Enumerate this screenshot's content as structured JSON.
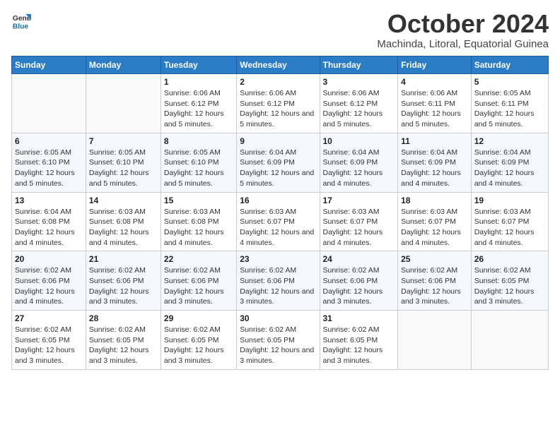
{
  "logo": {
    "line1": "General",
    "line2": "Blue"
  },
  "title": "October 2024",
  "location": "Machinda, Litoral, Equatorial Guinea",
  "days_of_week": [
    "Sunday",
    "Monday",
    "Tuesday",
    "Wednesday",
    "Thursday",
    "Friday",
    "Saturday"
  ],
  "weeks": [
    [
      {
        "num": "",
        "info": ""
      },
      {
        "num": "",
        "info": ""
      },
      {
        "num": "1",
        "info": "Sunrise: 6:06 AM\nSunset: 6:12 PM\nDaylight: 12 hours and 5 minutes."
      },
      {
        "num": "2",
        "info": "Sunrise: 6:06 AM\nSunset: 6:12 PM\nDaylight: 12 hours and 5 minutes."
      },
      {
        "num": "3",
        "info": "Sunrise: 6:06 AM\nSunset: 6:12 PM\nDaylight: 12 hours and 5 minutes."
      },
      {
        "num": "4",
        "info": "Sunrise: 6:06 AM\nSunset: 6:11 PM\nDaylight: 12 hours and 5 minutes."
      },
      {
        "num": "5",
        "info": "Sunrise: 6:05 AM\nSunset: 6:11 PM\nDaylight: 12 hours and 5 minutes."
      }
    ],
    [
      {
        "num": "6",
        "info": "Sunrise: 6:05 AM\nSunset: 6:10 PM\nDaylight: 12 hours and 5 minutes."
      },
      {
        "num": "7",
        "info": "Sunrise: 6:05 AM\nSunset: 6:10 PM\nDaylight: 12 hours and 5 minutes."
      },
      {
        "num": "8",
        "info": "Sunrise: 6:05 AM\nSunset: 6:10 PM\nDaylight: 12 hours and 5 minutes."
      },
      {
        "num": "9",
        "info": "Sunrise: 6:04 AM\nSunset: 6:09 PM\nDaylight: 12 hours and 5 minutes."
      },
      {
        "num": "10",
        "info": "Sunrise: 6:04 AM\nSunset: 6:09 PM\nDaylight: 12 hours and 4 minutes."
      },
      {
        "num": "11",
        "info": "Sunrise: 6:04 AM\nSunset: 6:09 PM\nDaylight: 12 hours and 4 minutes."
      },
      {
        "num": "12",
        "info": "Sunrise: 6:04 AM\nSunset: 6:09 PM\nDaylight: 12 hours and 4 minutes."
      }
    ],
    [
      {
        "num": "13",
        "info": "Sunrise: 6:04 AM\nSunset: 6:08 PM\nDaylight: 12 hours and 4 minutes."
      },
      {
        "num": "14",
        "info": "Sunrise: 6:03 AM\nSunset: 6:08 PM\nDaylight: 12 hours and 4 minutes."
      },
      {
        "num": "15",
        "info": "Sunrise: 6:03 AM\nSunset: 6:08 PM\nDaylight: 12 hours and 4 minutes."
      },
      {
        "num": "16",
        "info": "Sunrise: 6:03 AM\nSunset: 6:07 PM\nDaylight: 12 hours and 4 minutes."
      },
      {
        "num": "17",
        "info": "Sunrise: 6:03 AM\nSunset: 6:07 PM\nDaylight: 12 hours and 4 minutes."
      },
      {
        "num": "18",
        "info": "Sunrise: 6:03 AM\nSunset: 6:07 PM\nDaylight: 12 hours and 4 minutes."
      },
      {
        "num": "19",
        "info": "Sunrise: 6:03 AM\nSunset: 6:07 PM\nDaylight: 12 hours and 4 minutes."
      }
    ],
    [
      {
        "num": "20",
        "info": "Sunrise: 6:02 AM\nSunset: 6:06 PM\nDaylight: 12 hours and 4 minutes."
      },
      {
        "num": "21",
        "info": "Sunrise: 6:02 AM\nSunset: 6:06 PM\nDaylight: 12 hours and 3 minutes."
      },
      {
        "num": "22",
        "info": "Sunrise: 6:02 AM\nSunset: 6:06 PM\nDaylight: 12 hours and 3 minutes."
      },
      {
        "num": "23",
        "info": "Sunrise: 6:02 AM\nSunset: 6:06 PM\nDaylight: 12 hours and 3 minutes."
      },
      {
        "num": "24",
        "info": "Sunrise: 6:02 AM\nSunset: 6:06 PM\nDaylight: 12 hours and 3 minutes."
      },
      {
        "num": "25",
        "info": "Sunrise: 6:02 AM\nSunset: 6:06 PM\nDaylight: 12 hours and 3 minutes."
      },
      {
        "num": "26",
        "info": "Sunrise: 6:02 AM\nSunset: 6:05 PM\nDaylight: 12 hours and 3 minutes."
      }
    ],
    [
      {
        "num": "27",
        "info": "Sunrise: 6:02 AM\nSunset: 6:05 PM\nDaylight: 12 hours and 3 minutes."
      },
      {
        "num": "28",
        "info": "Sunrise: 6:02 AM\nSunset: 6:05 PM\nDaylight: 12 hours and 3 minutes."
      },
      {
        "num": "29",
        "info": "Sunrise: 6:02 AM\nSunset: 6:05 PM\nDaylight: 12 hours and 3 minutes."
      },
      {
        "num": "30",
        "info": "Sunrise: 6:02 AM\nSunset: 6:05 PM\nDaylight: 12 hours and 3 minutes."
      },
      {
        "num": "31",
        "info": "Sunrise: 6:02 AM\nSunset: 6:05 PM\nDaylight: 12 hours and 3 minutes."
      },
      {
        "num": "",
        "info": ""
      },
      {
        "num": "",
        "info": ""
      }
    ]
  ]
}
